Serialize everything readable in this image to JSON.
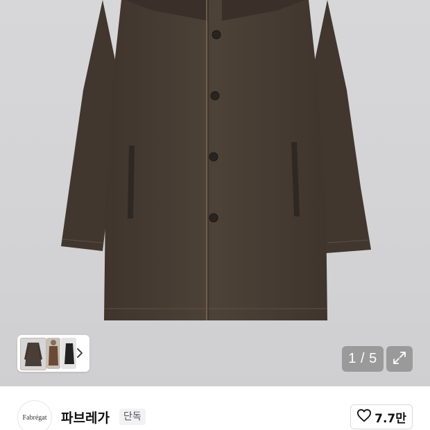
{
  "gallery": {
    "counter_text": "1 / 5",
    "thumbnails": [
      "coat-front",
      "model-wearing",
      "coat-dark"
    ]
  },
  "brand": {
    "logo_text": "Fabrégat",
    "name": "파브레가",
    "badge": "단독"
  },
  "like": {
    "count": "7.7만"
  },
  "colors": {
    "coat": "#4a3f36",
    "background": "#d5d5d7"
  },
  "icons": {
    "thumbnail_next": "chevron-right-icon",
    "expand": "expand-icon",
    "like": "heart-icon"
  }
}
